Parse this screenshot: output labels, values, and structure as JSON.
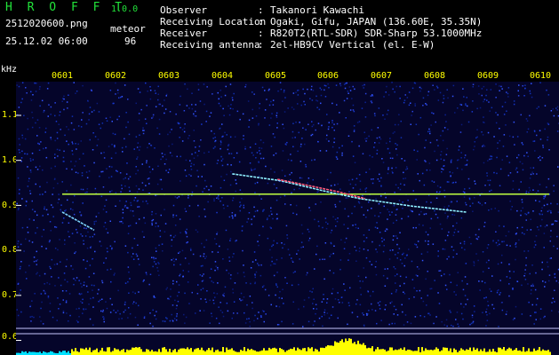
{
  "header": {
    "app_name": "H R O F F T",
    "version": "1.0.0",
    "filename": "2512020600.png",
    "datetime": "25.12.02 06:00",
    "meteor_label": "meteor",
    "meteor_count": "96",
    "info": [
      {
        "key": "Observer",
        "value": "Takanori Kawachi"
      },
      {
        "key": "Receiving Location",
        "value": "Ogaki, Gifu, JAPAN (136.60E, 35.35N)"
      },
      {
        "key": "Receiver",
        "value": "R820T2(RTL-SDR) SDR-Sharp 53.1000MHz"
      },
      {
        "key": "Receiving antenna",
        "value": "2el-HB9CV Vertical (el. E-W)"
      }
    ]
  },
  "axis": {
    "unit": "kHz",
    "time_ticks": [
      "0601",
      "0602",
      "0603",
      "0604",
      "0605",
      "0606",
      "0607",
      "0608",
      "0609",
      "0610"
    ],
    "freq_ticks": [
      "1.1",
      "1.0",
      "0.9",
      "0.8",
      "0.7",
      "0.6"
    ]
  },
  "colors": {
    "header_white": "#ffffff",
    "header_green": "#22e23a",
    "tick_yellow": "#ffff00",
    "spectrogram_bg": "#05052a",
    "carrier": "#bfff40",
    "level_fill": "#ffff00",
    "level_fill_alt": "#00e0ff"
  },
  "chart_data": {
    "type": "heatmap",
    "xlabel": "",
    "ylabel": "kHz",
    "x_ticks": [
      "0601",
      "0602",
      "0603",
      "0604",
      "0605",
      "0606",
      "0607",
      "0608",
      "0609",
      "0610"
    ],
    "y_ticks": [
      1.1,
      1.0,
      0.9,
      0.8,
      0.7,
      0.6
    ],
    "ylim": [
      0.58,
      1.2
    ],
    "xlim_minutes": [
      0.45,
      10.2
    ],
    "carrier_khz": 0.925,
    "grid": false
  }
}
